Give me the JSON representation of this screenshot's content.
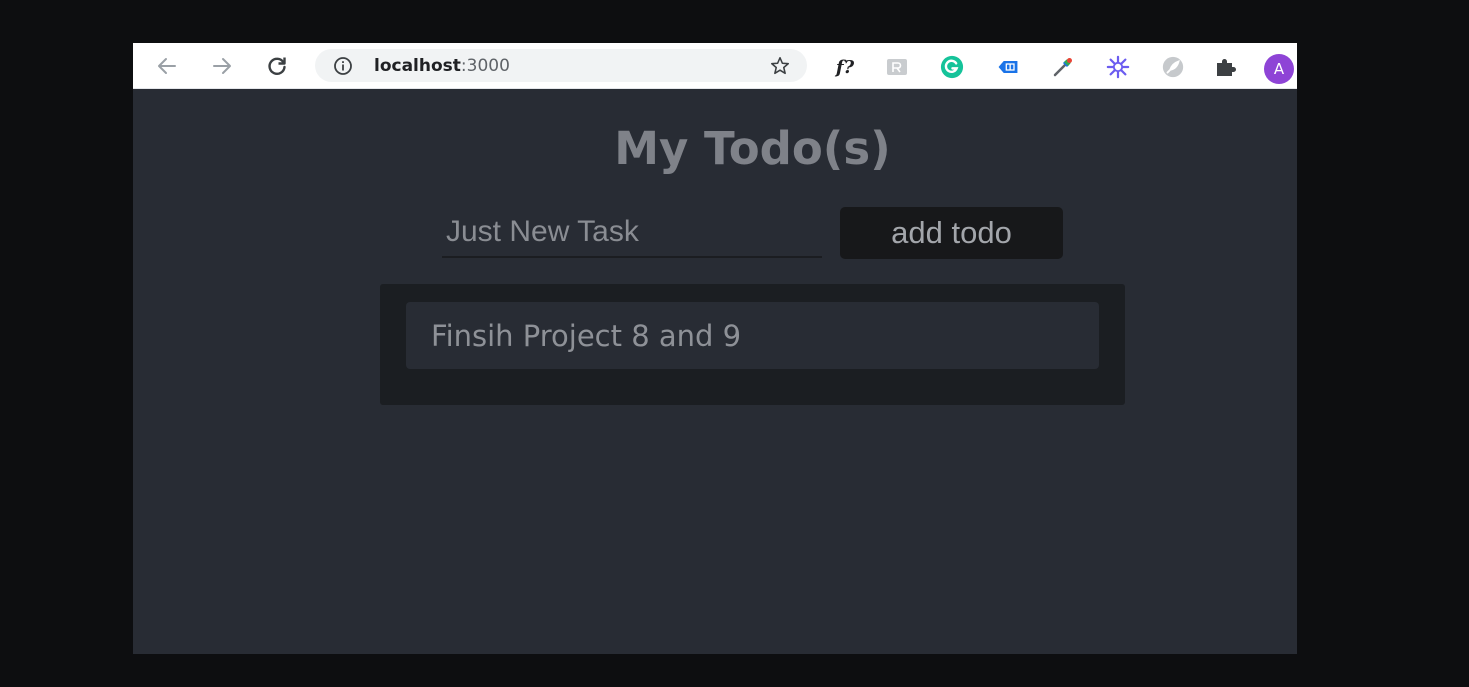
{
  "browser": {
    "url_host": "localhost",
    "url_port": ":3000",
    "extensions": [
      {
        "name": "fx-extension",
        "label": "f?"
      },
      {
        "name": "rx-extension"
      },
      {
        "name": "grammarly-extension",
        "color": "#15c39a"
      },
      {
        "name": "tab-extension",
        "color": "#1a73e8"
      },
      {
        "name": "color-picker-extension"
      },
      {
        "name": "star-burst-extension",
        "color": "#6b5cf0"
      },
      {
        "name": "feather-extension"
      },
      {
        "name": "extensions-puzzle"
      }
    ],
    "avatar_initial": "A",
    "avatar_color": "#8e44d6"
  },
  "app": {
    "title": "My Todo(s)",
    "input_placeholder": "Just New Task",
    "add_button_label": "add todo",
    "todos": [
      {
        "text": "Finsih Project 8 and 9"
      }
    ]
  },
  "colors": {
    "page_background": "#282c34",
    "panel_background": "#1b1e22",
    "button_background": "#17181a"
  }
}
